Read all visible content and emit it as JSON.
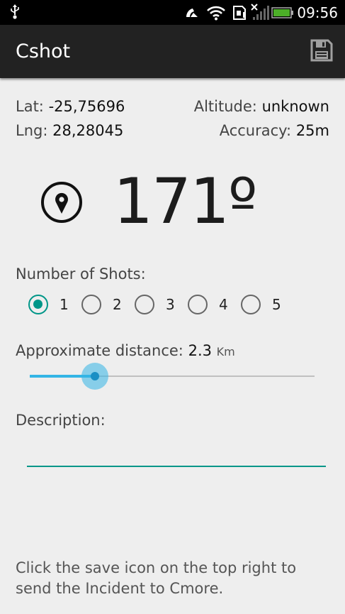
{
  "status_bar": {
    "time": "09:56",
    "icons": [
      "usb-icon",
      "notification-icon",
      "wifi-icon",
      "sd-card-icon",
      "signal-icon",
      "battery-icon"
    ],
    "battery_color": "#4caf28"
  },
  "action_bar": {
    "title": "Cshot",
    "save_icon": "save-icon"
  },
  "location": {
    "lat_label": "Lat:",
    "lat_value": "-25,75696",
    "lng_label": "Lng:",
    "lng_value": "28,28045",
    "altitude_label": "Altitude:",
    "altitude_value": "unknown",
    "accuracy_label": "Accuracy:",
    "accuracy_value": "25m"
  },
  "heading": {
    "icon": "compass-pin-icon",
    "value": "171º"
  },
  "shots": {
    "label": "Number of Shots:",
    "options": [
      "1",
      "2",
      "3",
      "4",
      "5"
    ],
    "selected": "1",
    "accent": "#009688"
  },
  "distance": {
    "label": "Approximate distance:",
    "value": "2.3",
    "unit": "Km",
    "slider_fraction": 0.23,
    "accent": "#33b5e5"
  },
  "description": {
    "label": "Description:",
    "value": "",
    "placeholder": ""
  },
  "footer": {
    "hint": "Click the save icon on the top right to send the Incident to Cmore."
  }
}
